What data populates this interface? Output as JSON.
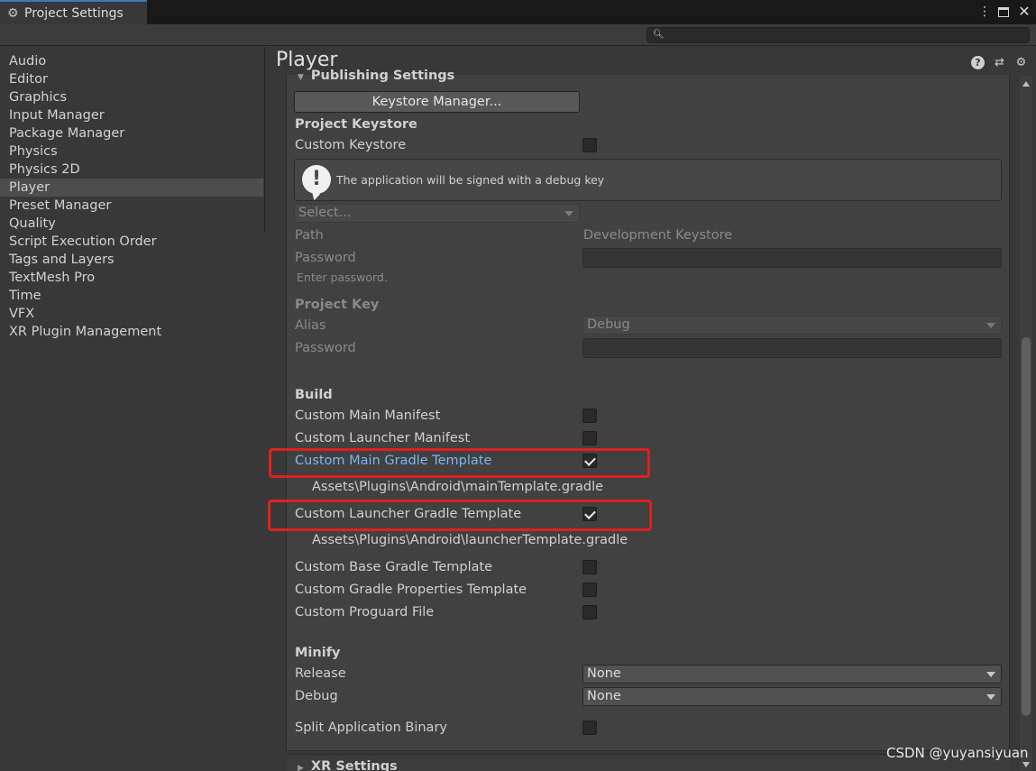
{
  "window": {
    "tab_title": "Project Settings",
    "tab_icon": "gear-icon",
    "controls": [
      "kebab-menu-icon",
      "maximize-icon",
      "close-icon"
    ]
  },
  "search": {
    "placeholder": "",
    "value": ""
  },
  "sidebar": {
    "items": [
      {
        "label": "Audio"
      },
      {
        "label": "Editor"
      },
      {
        "label": "Graphics"
      },
      {
        "label": "Input Manager"
      },
      {
        "label": "Package Manager"
      },
      {
        "label": "Physics"
      },
      {
        "label": "Physics 2D"
      },
      {
        "label": "Player",
        "selected": true
      },
      {
        "label": "Preset Manager"
      },
      {
        "label": "Quality"
      },
      {
        "label": "Script Execution Order"
      },
      {
        "label": "Tags and Layers"
      },
      {
        "label": "TextMesh Pro"
      },
      {
        "label": "Time"
      },
      {
        "label": "VFX"
      },
      {
        "label": "XR Plugin Management"
      }
    ]
  },
  "main": {
    "title": "Player",
    "header_icons": [
      "help-icon",
      "preset-icon",
      "settings-gear-icon"
    ],
    "publishing": {
      "section_title": "Publishing Settings",
      "keystore_manager_button": "Keystore Manager...",
      "project_keystore_heading": "Project Keystore",
      "custom_keystore_label": "Custom Keystore",
      "custom_keystore_checked": false,
      "help_message": "The application will be signed with a debug key",
      "select_placeholder": "Select...",
      "path_label": "Path",
      "path_value": "Development Keystore",
      "password_label": "Password",
      "password_hint": "Enter password.",
      "project_key_heading": "Project Key",
      "alias_label": "Alias",
      "alias_value": "Debug",
      "key_password_label": "Password"
    },
    "build": {
      "heading": "Build",
      "custom_main_manifest": {
        "label": "Custom Main Manifest",
        "checked": false
      },
      "custom_launcher_manifest": {
        "label": "Custom Launcher Manifest",
        "checked": false
      },
      "custom_main_gradle": {
        "label": "Custom Main Gradle Template",
        "checked": true,
        "path": "Assets\\Plugins\\Android\\mainTemplate.gradle"
      },
      "custom_launcher_gradle": {
        "label": "Custom Launcher Gradle Template",
        "checked": true,
        "path": "Assets\\Plugins\\Android\\launcherTemplate.gradle"
      },
      "custom_base_gradle": {
        "label": "Custom Base Gradle Template",
        "checked": false
      },
      "custom_gradle_props": {
        "label": "Custom Gradle Properties Template",
        "checked": false
      },
      "custom_proguard": {
        "label": "Custom Proguard File",
        "checked": false
      }
    },
    "minify": {
      "heading": "Minify",
      "release_label": "Release",
      "release_value": "None",
      "debug_label": "Debug",
      "debug_value": "None"
    },
    "split_binary": {
      "label": "Split Application Binary",
      "checked": false
    },
    "xr_section_title": "XR Settings"
  },
  "watermark": "CSDN @yuyansiyuan",
  "colors": {
    "highlight_border": "#e02020",
    "active_label": "#7bb6f2",
    "tab_accent": "#3a79bb"
  }
}
